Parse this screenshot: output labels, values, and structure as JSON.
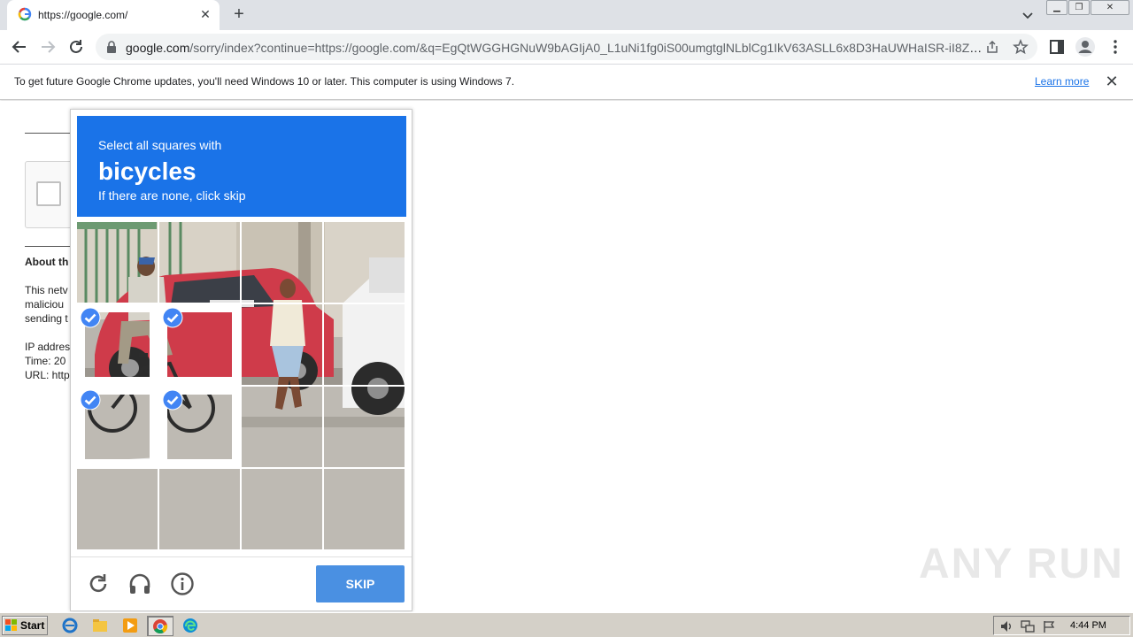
{
  "browser": {
    "tab_title": "https://google.com/",
    "url_host": "google.com",
    "url_rest": "/sorry/index?continue=https://google.com/&q=EgQtWGGHGNuW9bAGIjA0_L1uNi1fg0iS00umgtglNLblCg1IkV63ASLL6x8D3HaUWHaISR-iI8ZO...",
    "infobar_message": "To get future Google Chrome updates, you'll need Windows 10 or later. This computer is using Windows 7.",
    "infobar_link": "Learn more"
  },
  "page": {
    "about_heading": "About th",
    "lines": [
      "This netv",
      "maliciou",
      "sending t",
      "IP addres",
      "Time: 20",
      "URL: http"
    ]
  },
  "captcha": {
    "instruction": "Select all squares with",
    "target": "bicycles",
    "hint": "If there are none, click skip",
    "skip_label": "SKIP",
    "accent_color": "#1a73e8",
    "selected_cells": [
      4,
      5,
      8,
      9
    ]
  },
  "watermark": "ANY RUN",
  "taskbar": {
    "start_label": "Start",
    "clock": "4:44 PM"
  }
}
